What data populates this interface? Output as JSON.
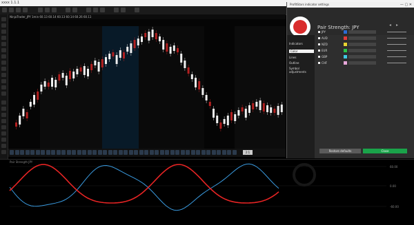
{
  "window": {
    "title": "xxxx 1.1.1"
  },
  "chart": {
    "info_line": "NinjaTrader_JPY 1min 60.13 60.14 60.13 60.14 60.26 60.11",
    "tabs": [
      "AUDJPY 1M",
      "NZDJPY",
      "EURJPY"
    ],
    "zoom_label": "2:1"
  },
  "oscillator": {
    "axis_labels": [
      "60.00",
      "0.00",
      "-60.00"
    ],
    "legend": "Pair Strength JPY"
  },
  "panel": {
    "title": "ProfitStars indicator settings",
    "indicator_name": "Pair Strength: JPY",
    "side_items": [
      "Indicators",
      "Color",
      "Lines",
      "Outline",
      "Symbol adjustments"
    ],
    "rows": [
      {
        "label": "JPY",
        "color": "#2b6cd6",
        "value": ""
      },
      {
        "label": "AUD",
        "color": "#e23b3b",
        "value": ""
      },
      {
        "label": "NZD",
        "color": "#e8d431",
        "value": ""
      },
      {
        "label": "EUR",
        "color": "#2bc447",
        "value": ""
      },
      {
        "label": "GBP",
        "color": "#40c9e3",
        "value": ""
      },
      {
        "label": "CHF",
        "color": "#e7a7d9",
        "value": ""
      }
    ],
    "btn_left": "Restore defaults",
    "btn_right": "Close"
  },
  "colors": {
    "accent": "#1aa34a",
    "series_blue": "#3a9be0",
    "series_red": "#e82424"
  }
}
